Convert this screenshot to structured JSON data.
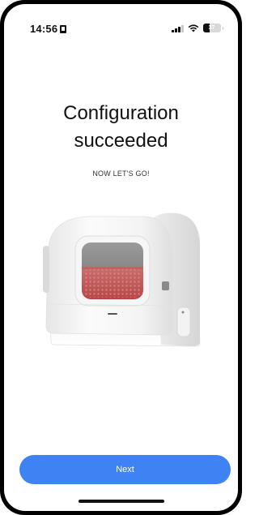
{
  "status_bar": {
    "time": "14:56",
    "battery_text": "37",
    "battery_level": 0.37,
    "icons": [
      "sim-card-icon",
      "cellular-signal-icon",
      "wifi-icon",
      "battery-icon"
    ]
  },
  "main": {
    "title_line1": "Configuration",
    "title_line2": "succeeded",
    "subtitle": "NOW LET'S GO!"
  },
  "footer": {
    "next_label": "Next"
  },
  "colors": {
    "accent": "#3e82f4",
    "background": "#ffffff",
    "text": "#111111"
  }
}
